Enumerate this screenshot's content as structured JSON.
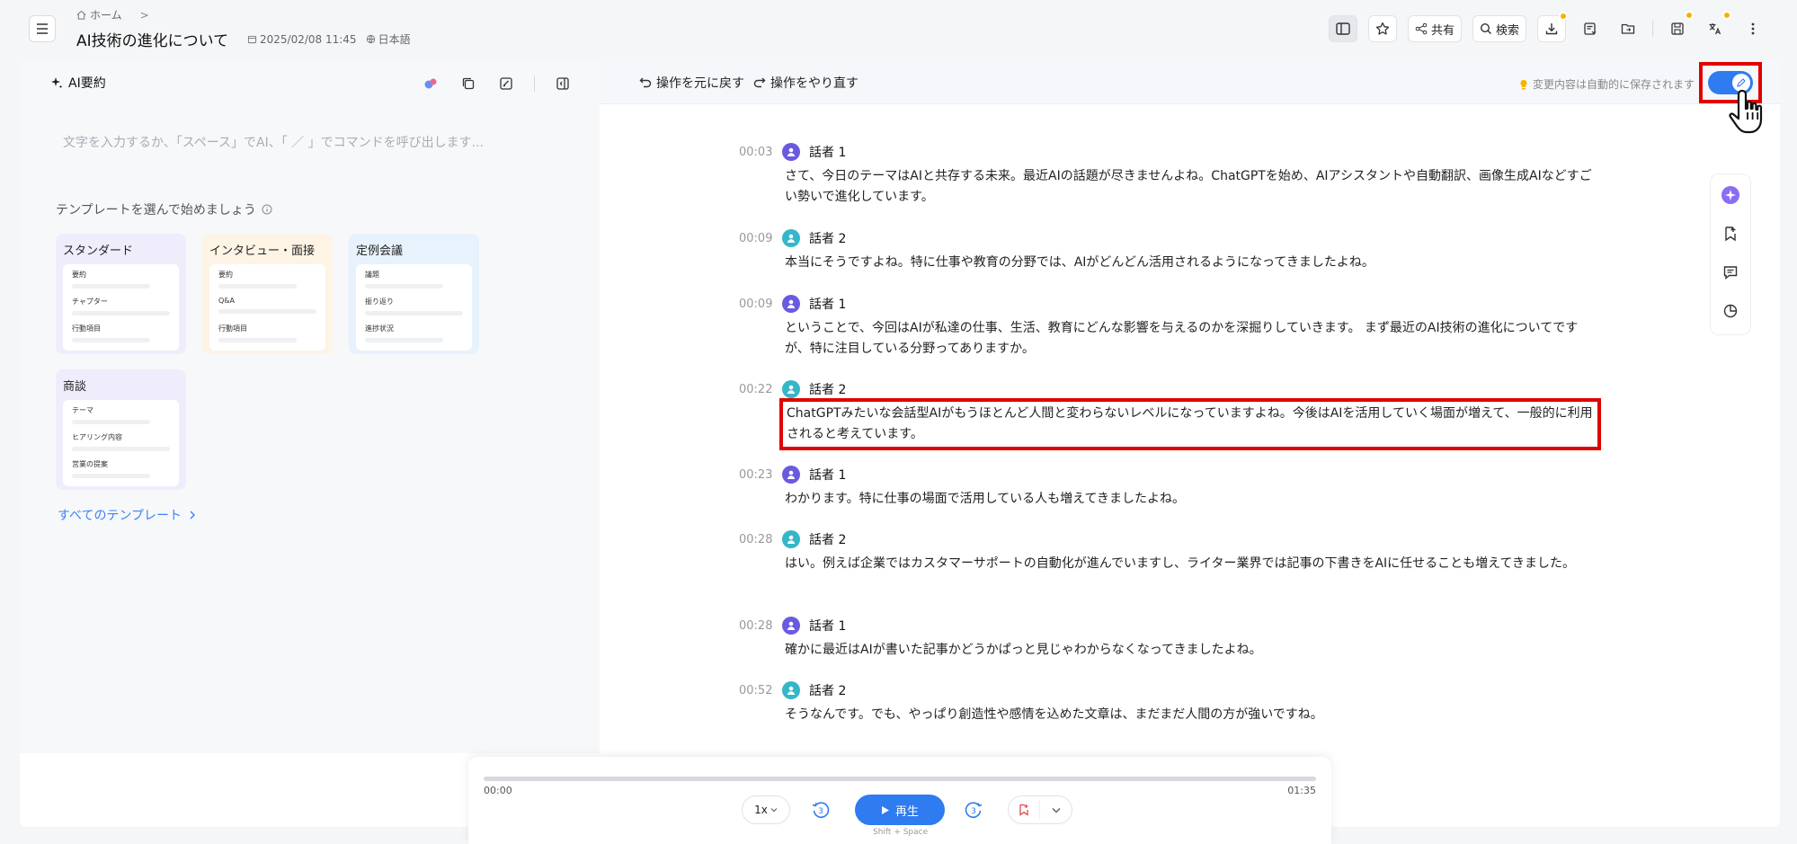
{
  "header": {
    "breadcrumb_home": "ホーム",
    "breadcrumb_sep": ">",
    "title": "AI技術の進化について",
    "date": "2025/02/08 11:45",
    "language": "日本語",
    "share_label": "共有",
    "search_label": "検索"
  },
  "left": {
    "title": "AI要約",
    "placeholder": "文字を入力するか、「スペース」でAI、「 ／ 」でコマンドを呼び出します...",
    "template_heading": "テンプレートを選んで始めましょう",
    "templates": [
      {
        "title": "スタンダード",
        "rows": [
          "要約",
          "チャプター",
          "行動項目"
        ]
      },
      {
        "title": "インタビュー・面接",
        "rows": [
          "要約",
          "Q&A",
          "行動項目"
        ]
      },
      {
        "title": "定例会議",
        "rows": [
          "議題",
          "振り返り",
          "進捗状況"
        ]
      },
      {
        "title": "商談",
        "rows": [
          "テーマ",
          "ヒアリング内容",
          "営業の提案"
        ]
      }
    ],
    "all_templates": "すべてのテンプレート"
  },
  "editor": {
    "undo_label": "操作を元に戻す",
    "redo_label": "操作をやり直す",
    "autosave_note": "変更内容は自動的に保存されます",
    "edit_mode_on": true
  },
  "transcript": [
    {
      "time": "00:03",
      "speaker": "話者 1",
      "speaker_id": 1,
      "text": "さて、今日のテーマはAIと共存する未来。最近AIの話題が尽きませんよね。ChatGPTを始め、AIアシスタントや自動翻訳、画像生成AIなどすごい勢いで進化しています。"
    },
    {
      "time": "00:09",
      "speaker": "話者 2",
      "speaker_id": 2,
      "text": "本当にそうですよね。特に仕事や教育の分野では、AIがどんどん活用されるようになってきましたよね。"
    },
    {
      "time": "00:09",
      "speaker": "話者 1",
      "speaker_id": 1,
      "text": "ということで、今回はAIが私達の仕事、生活、教育にどんな影響を与えるのかを深掘りしていきます。 まず最近のAI技術の進化についてですが、特に注目している分野ってありますか。"
    },
    {
      "time": "00:22",
      "speaker": "話者 2",
      "speaker_id": 2,
      "text": "ChatGPTみたいな会話型AIがもうほとんど人間と変わらないレベルになっていますよね。今後はAIを活用していく場面が増えて、一般的に利用されると考えています。"
    },
    {
      "time": "00:23",
      "speaker": "話者 1",
      "speaker_id": 1,
      "text": "わかります。特に仕事の場面で活用している人も増えてきましたよね。"
    },
    {
      "time": "00:28",
      "speaker": "話者 2",
      "speaker_id": 2,
      "text": "はい。例えば企業ではカスタマーサポートの自動化が進んでいますし、ライター業界では記事の下書きをAIに任せることも増えてきました。"
    },
    {
      "time": "00:28",
      "speaker": "話者 1",
      "speaker_id": 1,
      "text": "確かに最近はAIが書いた記事かどうかぱっと見じゃわからなくなってきましたよね。"
    },
    {
      "time": "00:52",
      "speaker": "話者 2",
      "speaker_id": 2,
      "text": "そうなんです。でも、やっぱり創造性や感情を込めた文章は、まだまだ人間の方が強いですね。"
    }
  ],
  "player": {
    "current_time": "00:00",
    "duration": "01:35",
    "progress": 0.0,
    "speed": "1x",
    "skip_seconds": "3",
    "play_label": "再生",
    "shortcut_hint": "Shift + Space"
  },
  "colors": {
    "accent": "#2f7bf0",
    "highlight": "#e00000",
    "speaker1": "#6a5ae0",
    "speaker2": "#35b6c9"
  }
}
